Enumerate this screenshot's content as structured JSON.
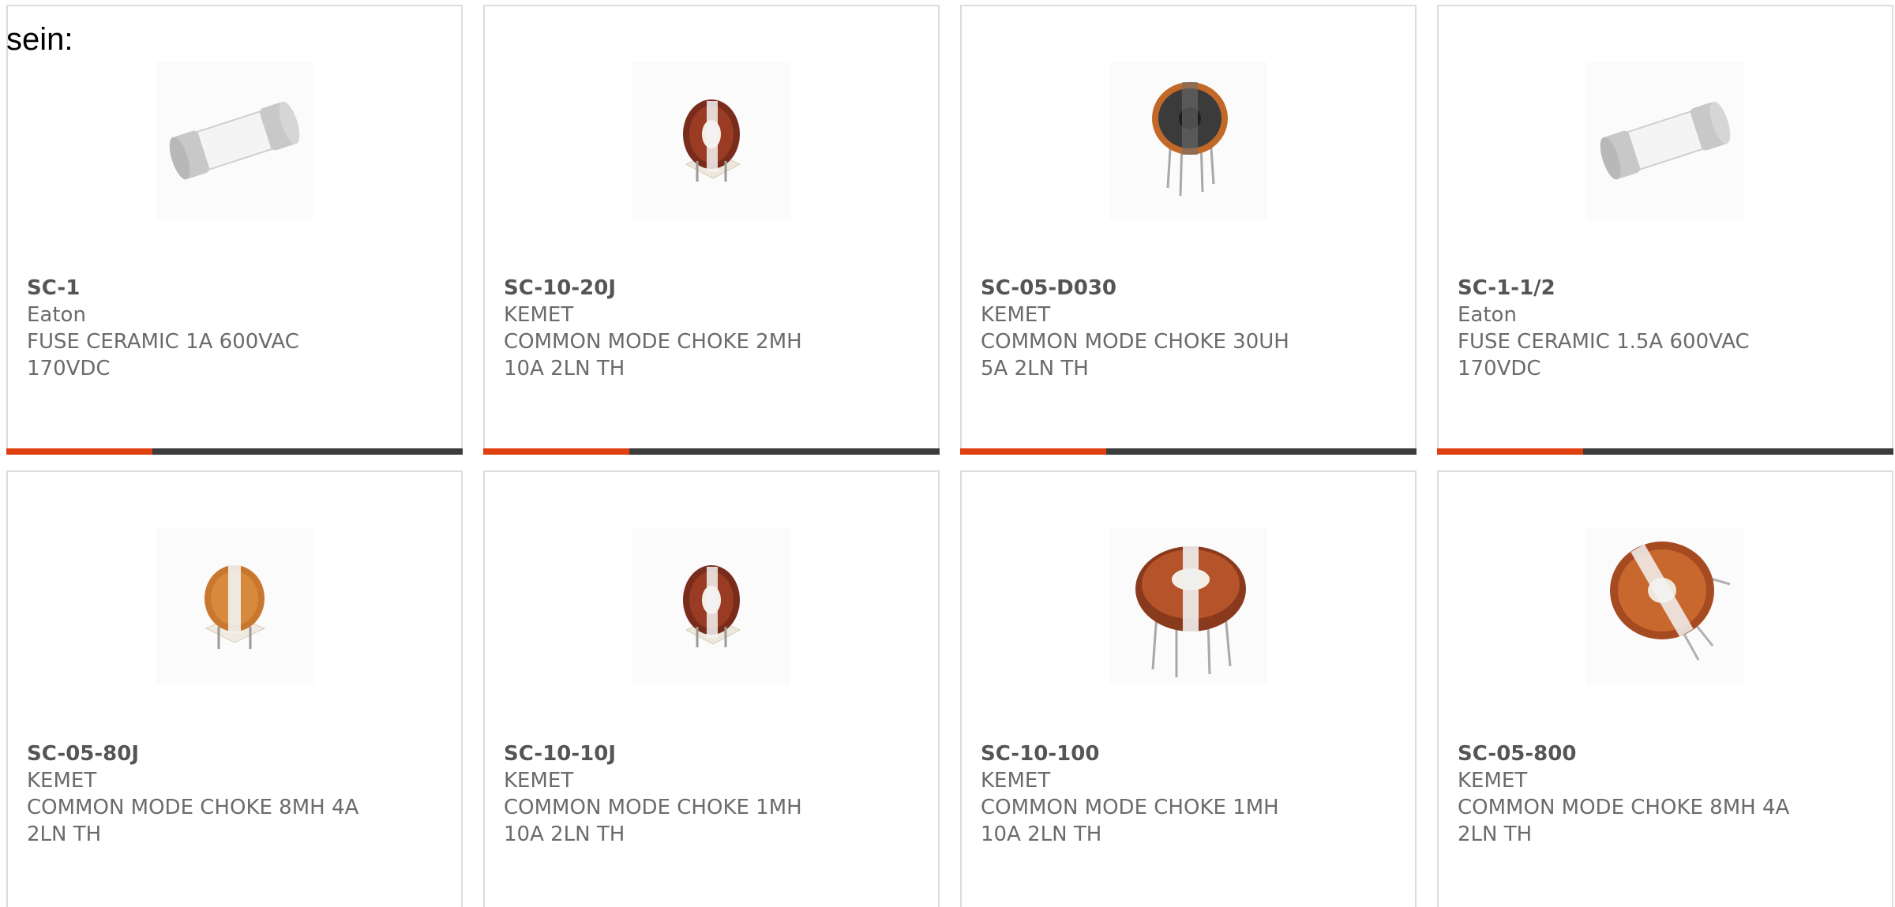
{
  "intro_text": "sein:",
  "colors": {
    "accent": "#e0400f",
    "bar": "#3c3c3c",
    "border": "#dcdcdc"
  },
  "products": [
    {
      "part_number": "SC-1",
      "manufacturer": "Eaton",
      "description": "FUSE CERAMIC 1A 600VAC 170VDC",
      "image_icon": "ceramic-fuse-icon"
    },
    {
      "part_number": "SC-10-20J",
      "manufacturer": "KEMET",
      "description": "COMMON MODE CHOKE 2MH 10A 2LN TH",
      "image_icon": "common-mode-choke-icon"
    },
    {
      "part_number": "SC-05-D030",
      "manufacturer": "KEMET",
      "description": "COMMON MODE CHOKE 30UH 5A 2LN TH",
      "image_icon": "common-mode-choke-icon"
    },
    {
      "part_number": "SC-1-1/2",
      "manufacturer": "Eaton",
      "description": "FUSE CERAMIC 1.5A 600VAC 170VDC",
      "image_icon": "ceramic-fuse-icon"
    },
    {
      "part_number": "SC-05-80J",
      "manufacturer": "KEMET",
      "description": "COMMON MODE CHOKE 8MH 4A 2LN TH",
      "image_icon": "common-mode-choke-icon"
    },
    {
      "part_number": "SC-10-10J",
      "manufacturer": "KEMET",
      "description": "COMMON MODE CHOKE 1MH 10A 2LN TH",
      "image_icon": "common-mode-choke-icon"
    },
    {
      "part_number": "SC-10-100",
      "manufacturer": "KEMET",
      "description": "COMMON MODE CHOKE 1MH 10A 2LN TH",
      "image_icon": "common-mode-choke-icon"
    },
    {
      "part_number": "SC-05-800",
      "manufacturer": "KEMET",
      "description": "COMMON MODE CHOKE 8MH 4A 2LN TH",
      "image_icon": "common-mode-choke-icon"
    }
  ]
}
